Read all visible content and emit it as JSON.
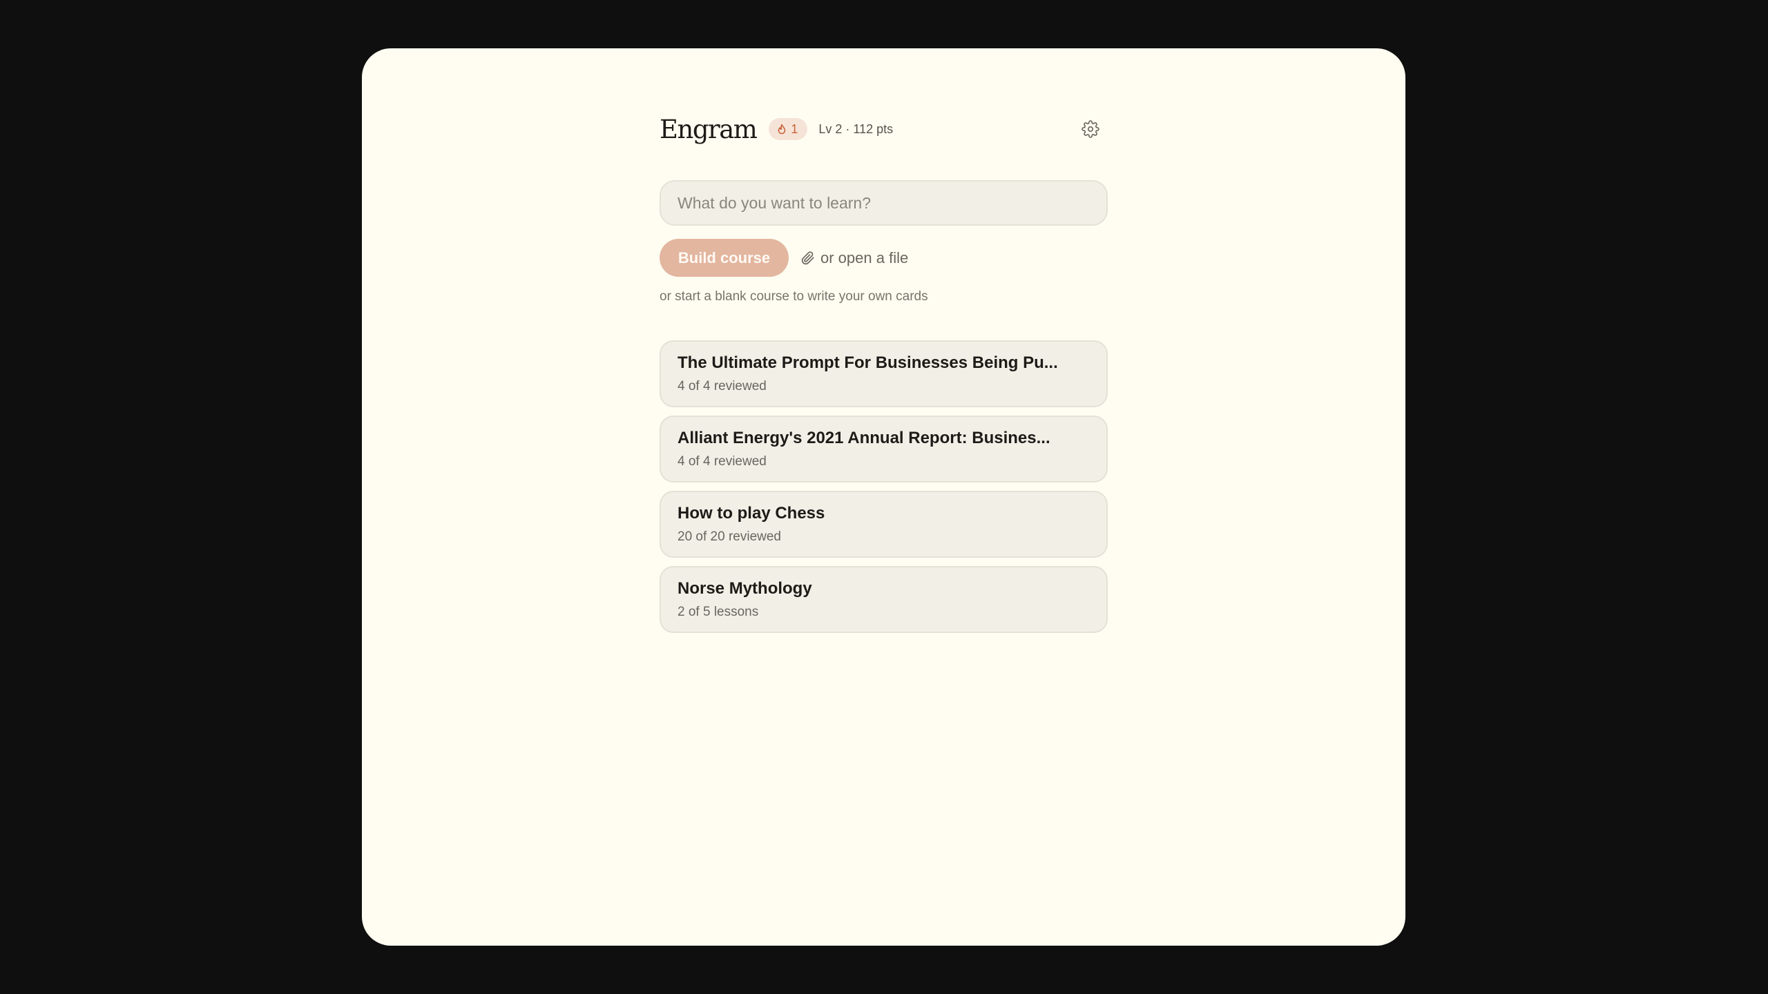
{
  "header": {
    "brand": "Engram",
    "streak": "1",
    "level": "Lv 2 · 112 pts"
  },
  "search": {
    "placeholder": "What do you want to learn?"
  },
  "actions": {
    "build_label": "Build course",
    "open_file_label": "or open a file",
    "blank_link": "or start a blank course to write your own cards"
  },
  "courses": [
    {
      "title": "The Ultimate Prompt For Businesses Being Pu...",
      "progress": "4 of 4 reviewed"
    },
    {
      "title": "Alliant Energy's 2021 Annual Report: Busines...",
      "progress": "4 of 4 reviewed"
    },
    {
      "title": "How to play Chess",
      "progress": "20 of 20 reviewed"
    },
    {
      "title": "Norse Mythology",
      "progress": "2 of 5 lessons"
    }
  ],
  "colors": {
    "background": "#fffdf1",
    "accent": "#e3b6a0",
    "streak": "#c9623a"
  }
}
